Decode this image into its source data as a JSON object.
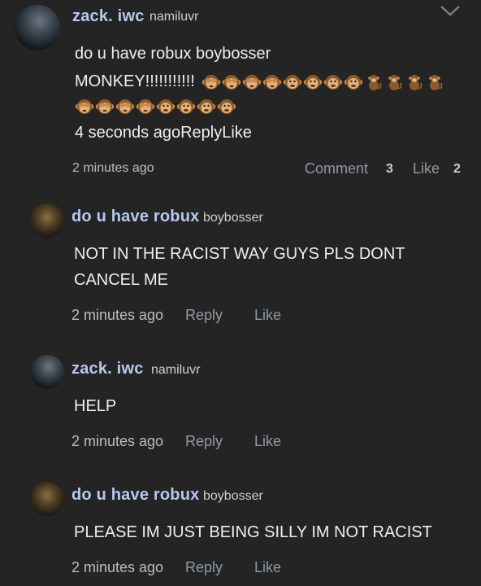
{
  "top_comment": {
    "username": "zack. iwc",
    "handle": "namiluvr",
    "lines": [
      "do u have robux boybosser",
      "MONKEY!!!!!!!!!!!"
    ],
    "quoted_meta": "4 seconds agoReplyLike",
    "time": "2 minutes ago",
    "comment_label": "Comment",
    "comment_count": "3",
    "like_label": "Like",
    "like_count": "2",
    "emoji_row1": [
      "see-no-evil-monkey",
      "see-no-evil-monkey",
      "see-no-evil-monkey",
      "see-no-evil-monkey",
      "monkey-face",
      "monkey-face",
      "monkey-face",
      "monkey-face",
      "monkey",
      "monkey",
      "monkey",
      "monkey"
    ],
    "emoji_row2": [
      "see-no-evil-monkey",
      "see-no-evil-monkey",
      "see-no-evil-monkey",
      "see-no-evil-monkey",
      "monkey-face",
      "monkey-face",
      "monkey-face",
      "monkey-face"
    ]
  },
  "replies": [
    {
      "username": "do u have robux",
      "handle": "boybosser",
      "text_lines": [
        "NOT IN THE RACIST WAY GUYS PLS DONT",
        "CANCEL ME"
      ],
      "time": "2 minutes ago",
      "reply_label": "Reply",
      "like_label": "Like"
    },
    {
      "username": "zack. iwc",
      "handle": "namiluvr",
      "text_lines": [
        "HELP"
      ],
      "time": "2 minutes ago",
      "reply_label": "Reply",
      "like_label": "Like"
    },
    {
      "username": "do u have robux",
      "handle": "boybosser",
      "text_lines": [
        "PLEASE IM JUST BEING SILLY IM NOT RACIST"
      ],
      "time": "2 minutes ago",
      "reply_label": "Reply",
      "like_label": "Like"
    }
  ],
  "colors": {
    "background": "#242424",
    "username": "#b6c9ef",
    "action": "#8f9aa6"
  }
}
